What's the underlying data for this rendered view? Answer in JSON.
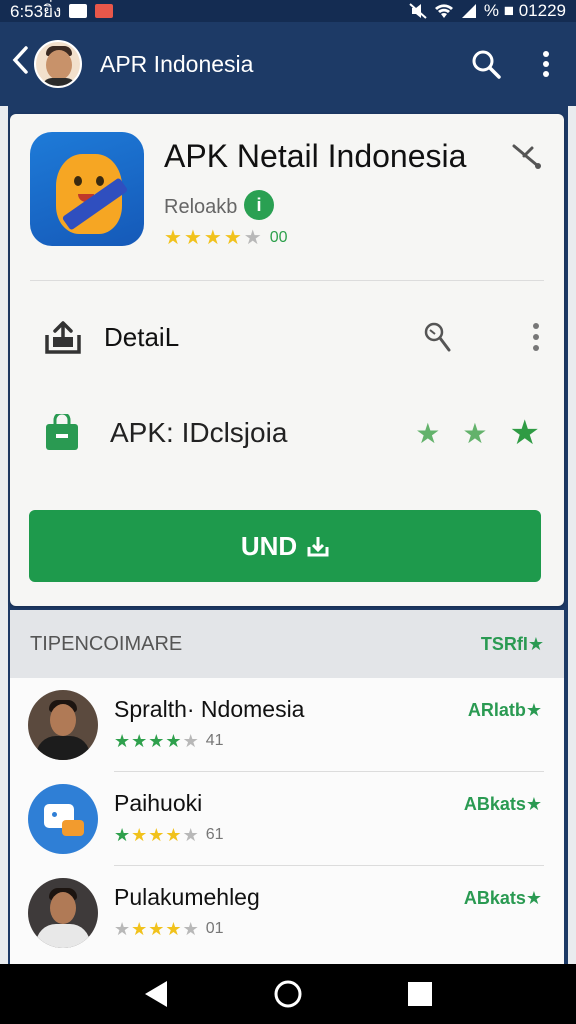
{
  "status_bar": {
    "time": "6:53ยิ่ง",
    "battery_text": "% ■ 01229"
  },
  "app_bar": {
    "title": "APR Indonesia"
  },
  "app": {
    "title": "APK Netail Indonesia",
    "subtitle": "Reloakb",
    "info_badge": "i",
    "rating_text": "00",
    "rating_stars": 4
  },
  "detail": {
    "label": "DetaiL"
  },
  "apk_row": {
    "label": "APK: IDclsjoia"
  },
  "install_button": {
    "label": "UND"
  },
  "section": {
    "title": "TIPENCOIMARE",
    "link": "TSRfI★"
  },
  "list": [
    {
      "title": "Spralth· Ndomesia",
      "rating_text": "41",
      "action": "ARlatb★",
      "stars": 4
    },
    {
      "title": "Paihuoki",
      "rating_text": "61",
      "action": "ABkats★",
      "stars": 4
    },
    {
      "title": "Pulakumehleg",
      "rating_text": "01",
      "action": "ABkats★",
      "stars": 4
    }
  ],
  "colors": {
    "appbar": "#1d3a66",
    "primary_green": "#1e9a4c",
    "star_gold": "#f1c21c",
    "star_green": "#2ea04c"
  }
}
